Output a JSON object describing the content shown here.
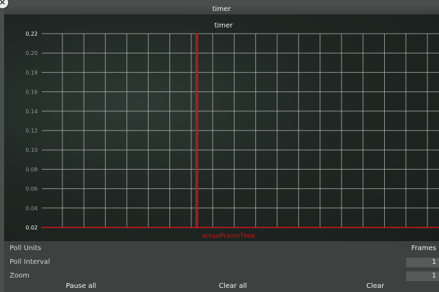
{
  "window": {
    "title": "timer"
  },
  "chart_data": {
    "type": "line",
    "title": "timer",
    "ylim": [
      0.02,
      0.22
    ],
    "yticks": [
      "0.22",
      "0.20",
      "0.18",
      "0.16",
      "0.14",
      "0.12",
      "0.10",
      "0.08",
      "0.06",
      "0.04",
      "0.02"
    ],
    "series": [
      {
        "name": "actualFrameTime",
        "baseline": 0.02,
        "spike_x_fraction": 0.39,
        "spike_value": 0.22
      }
    ],
    "grid": true,
    "colors": {
      "series": "#c81818",
      "grid": "#b8bebc",
      "background": "#1c2421"
    }
  },
  "controls": {
    "poll_units_label": "Poll Units",
    "poll_units_value": "Frames",
    "poll_interval_label": "Poll Interval",
    "poll_interval_value": "1",
    "zoom_label": "Zoom",
    "zoom_value": "1"
  },
  "buttons": {
    "pause_all": "Pause all",
    "clear_all": "Clear all",
    "clear": "Clear"
  }
}
